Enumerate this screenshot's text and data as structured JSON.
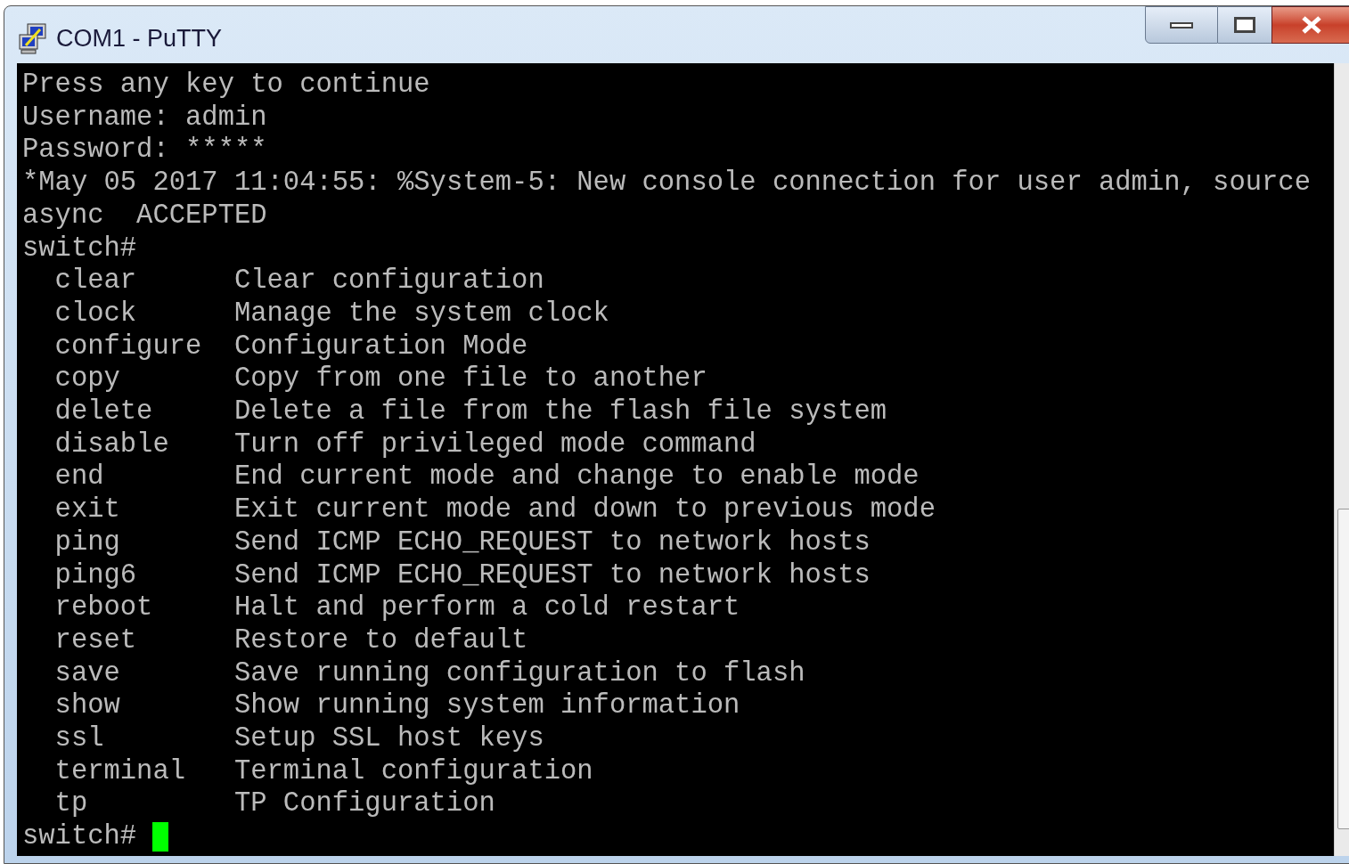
{
  "window": {
    "title": "COM1 - PuTTY"
  },
  "terminal": {
    "lines": [
      "Press any key to continue",
      "Username: admin",
      "Password: *****",
      "*May 05 2017 11:04:55: %System-5: New console connection for user admin, source",
      "async  ACCEPTED",
      "switch#"
    ],
    "help": [
      {
        "command": "clear",
        "description": "Clear configuration"
      },
      {
        "command": "clock",
        "description": "Manage the system clock"
      },
      {
        "command": "configure",
        "description": "Configuration Mode"
      },
      {
        "command": "copy",
        "description": "Copy from one file to another"
      },
      {
        "command": "delete",
        "description": "Delete a file from the flash file system"
      },
      {
        "command": "disable",
        "description": "Turn off privileged mode command"
      },
      {
        "command": "end",
        "description": "End current mode and change to enable mode"
      },
      {
        "command": "exit",
        "description": "Exit current mode and down to previous mode"
      },
      {
        "command": "ping",
        "description": "Send ICMP ECHO_REQUEST to network hosts"
      },
      {
        "command": "ping6",
        "description": "Send ICMP ECHO_REQUEST to network hosts"
      },
      {
        "command": "reboot",
        "description": "Halt and perform a cold restart"
      },
      {
        "command": "reset",
        "description": "Restore to default"
      },
      {
        "command": "save",
        "description": "Save running configuration to flash"
      },
      {
        "command": "show",
        "description": "Show running system information"
      },
      {
        "command": "ssl",
        "description": "Setup SSL host keys"
      },
      {
        "command": "terminal",
        "description": "Terminal configuration"
      },
      {
        "command": "tp",
        "description": "TP Configuration"
      }
    ],
    "prompt": "switch#"
  }
}
